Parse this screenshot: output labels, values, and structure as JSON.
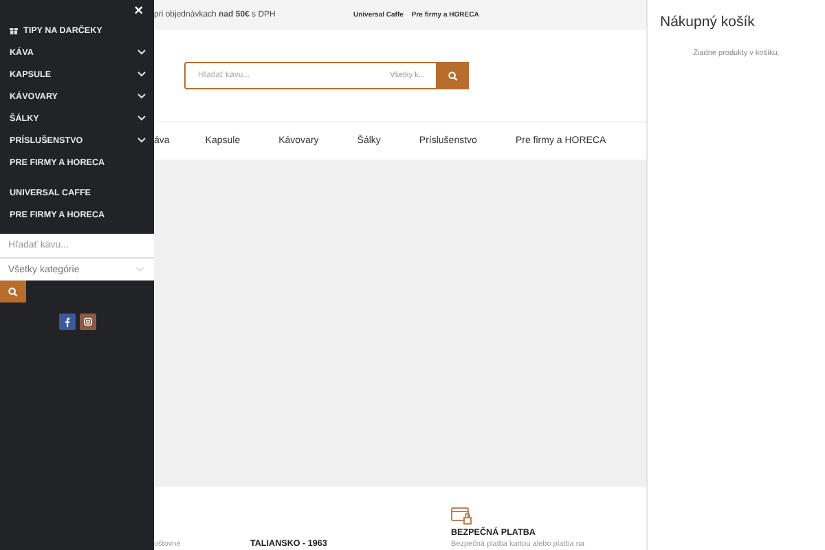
{
  "sidebar": {
    "close": "×",
    "items": [
      {
        "label": "TIPY NA DARČEKY",
        "kind": "gift"
      },
      {
        "label": "KÁVA",
        "kind": "submenu",
        "expanded": false
      },
      {
        "label": "KAPSULE",
        "kind": "submenu",
        "expanded": false
      },
      {
        "label": "KÁVOVARY",
        "kind": "submenu",
        "expanded": false
      },
      {
        "label": "ŠÁLKY",
        "kind": "submenu",
        "expanded": false
      },
      {
        "label": "PRÍSLUŠENSTVO",
        "kind": "submenu",
        "expanded": false
      },
      {
        "label": "PRE FIRMY A HORECA",
        "kind": "link"
      }
    ],
    "links": [
      "UNIVERSAL CAFFE",
      "PRE FIRMY A HORECA"
    ],
    "search": {
      "placeholder": "Hľadať kávu..."
    },
    "category": {
      "value": "Všetky kategórie"
    }
  },
  "top_bar": {
    "notice": "pri objednávkach **nad 50€** s DPH",
    "links": [
      "Universal Caffe",
      "Pre firmy a HORECA"
    ]
  },
  "header_search": {
    "placeholder": "Hľadať kávu...",
    "category": "Všetky k..."
  },
  "nav": [
    "áva",
    "Kapsule",
    "Kávovary",
    "Šálky",
    "Príslušenstvo",
    "Pre firmy a HORECA"
  ],
  "features": [
    {
      "text": "oštovné"
    },
    {
      "title": "TALIANSKO - 1963"
    },
    {
      "title": "BEZPEČNÁ PLATBA",
      "text": "Bezpečná platba kartou alebo platba na",
      "icon": true
    }
  ],
  "cart": {
    "title": "Nákupný košík",
    "empty": "Žiadne produkty v košíku."
  }
}
